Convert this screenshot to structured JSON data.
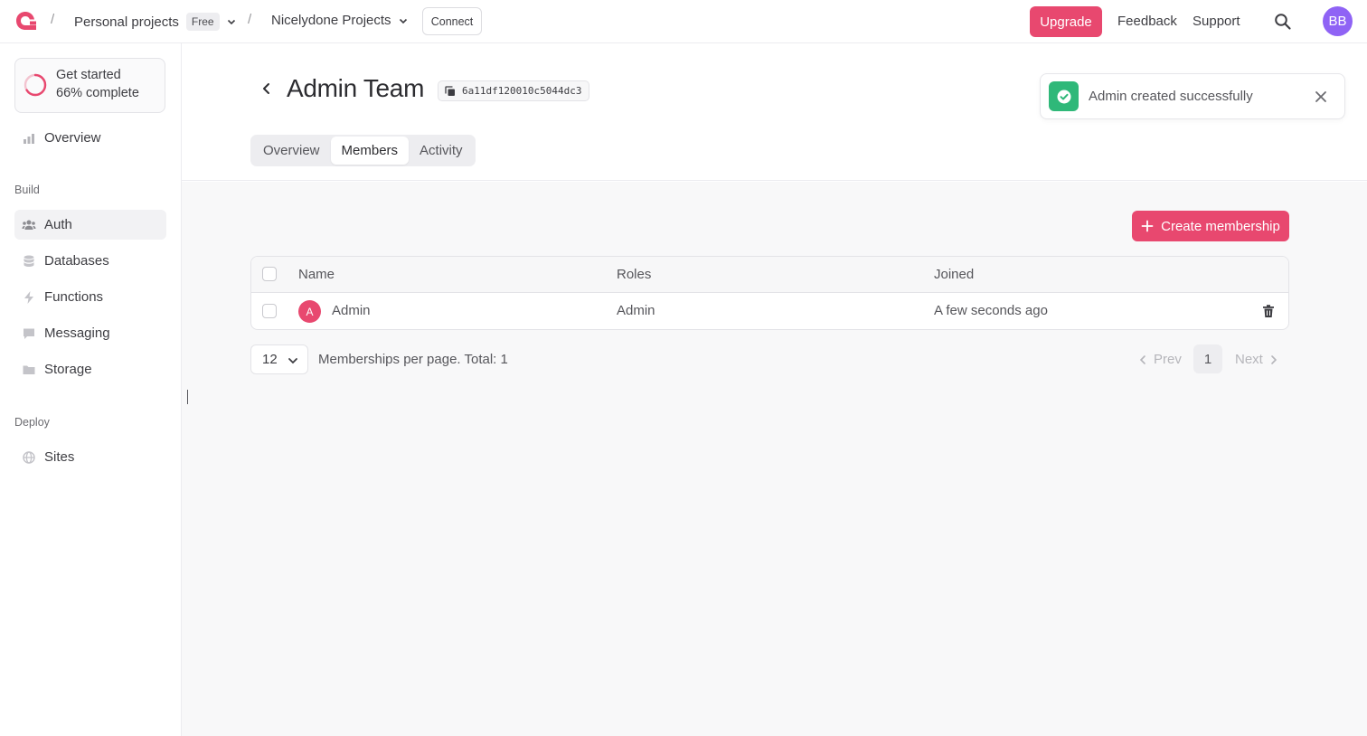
{
  "topbar": {
    "org": "Personal projects",
    "plan_badge": "Free",
    "project": "Nicelydone Projects",
    "connect_label": "Connect",
    "upgrade_label": "Upgrade",
    "feedback_label": "Feedback",
    "support_label": "Support",
    "avatar_initials": "BB",
    "separator": "/"
  },
  "sidebar": {
    "get_started": {
      "title": "Get started",
      "progress_text": "66% complete",
      "progress": 0.66
    },
    "overview_label": "Overview",
    "build_section": "Build",
    "build_items": [
      {
        "label": "Auth",
        "icon": "users-icon",
        "active": true
      },
      {
        "label": "Databases",
        "icon": "database-icon",
        "active": false
      },
      {
        "label": "Functions",
        "icon": "lightning-icon",
        "active": false
      },
      {
        "label": "Messaging",
        "icon": "chat-icon",
        "active": false
      },
      {
        "label": "Storage",
        "icon": "folder-icon",
        "active": false
      }
    ],
    "deploy_section": "Deploy",
    "deploy_items": [
      {
        "label": "Sites",
        "icon": "globe-icon"
      }
    ]
  },
  "page": {
    "title": "Admin Team",
    "id": "6a11df120010c5044dc3",
    "tabs": [
      "Overview",
      "Members",
      "Activity"
    ],
    "active_tab": "Members"
  },
  "toast": {
    "message": "Admin created successfully"
  },
  "members": {
    "create_label": "Create membership",
    "columns": [
      "Name",
      "Roles",
      "Joined"
    ],
    "rows": [
      {
        "initial": "A",
        "name": "Admin",
        "roles": "Admin",
        "joined": "A few seconds ago"
      }
    ],
    "per_page": "12",
    "per_page_text": "Memberships per page. Total: 1",
    "prev_label": "Prev",
    "next_label": "Next",
    "current_page": "1"
  },
  "colors": {
    "accent": "#e8486f",
    "success": "#2fb879",
    "avatar": "#8f63f5"
  }
}
